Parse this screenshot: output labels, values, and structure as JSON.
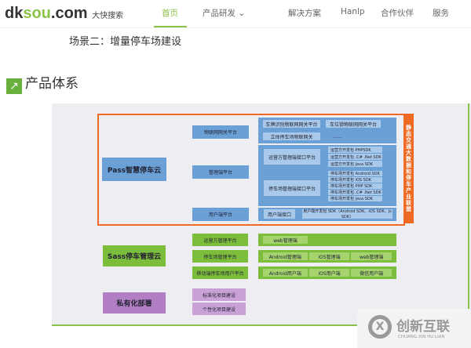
{
  "header": {
    "logo": {
      "a": "dk",
      "b": "sou",
      "c": ".com",
      "sub": "大快搜索"
    },
    "nav": [
      "首页",
      "产品研发 ⌄",
      "解决方案",
      "Hanlp",
      "合作伙伴",
      "服务"
    ]
  },
  "scene_title": "场景二：增量停车场建设",
  "section": {
    "icon": "↗",
    "title": "产品体系"
  },
  "diagram": {
    "pass": {
      "title": "Pass智慧停车云",
      "side": "静态交通大数据和停车产业联盟",
      "platforms": [
        "物联网网关平台",
        "管理端平台",
        "用户端平台"
      ],
      "iot": [
        "车牌识别物联网网关平台",
        "车位锁物联网网关平台",
        "立体停车场物联网关",
        "......"
      ],
      "mgmt": {
        "op": "运营方管理端接口平台",
        "op_sdk": [
          "运营方开发包 PHPSDK",
          "运营方开发包 .C# .Net SDK",
          "运营方开发包 java SDK"
        ],
        "park": "停车场管理端接口平台",
        "park_sdk": [
          "停车场开发包 Android SDK",
          "停车场开发包 iOS SDK",
          "停车场开发包 PHP SDK",
          "停车场开发包 .C# .Net SDK",
          "停车场开发包 java SDK"
        ]
      },
      "user": {
        "api": "用户端接口",
        "sdk": "用户端开发包 SDK（Android SDK、iOS SDK、js SDK）"
      }
    },
    "sass": {
      "title": "Sass停车管理云",
      "platforms": [
        "运营方管理平台",
        "停车场管理平台",
        "移动端停车场用户平台"
      ],
      "rows": [
        [
          "web管理端"
        ],
        [
          "Android管理端",
          "iOS管理端",
          "web管理端"
        ],
        [
          "Android用户端",
          "iOS用户端",
          "微信用户端"
        ]
      ]
    },
    "private": {
      "title": "私有化部署",
      "items": [
        "标准化项目建设",
        "个性化项目建设"
      ]
    }
  },
  "watermark": {
    "cn": "创新互联",
    "en": "CHUANG XIN HU LIAN",
    "icon": "X"
  }
}
